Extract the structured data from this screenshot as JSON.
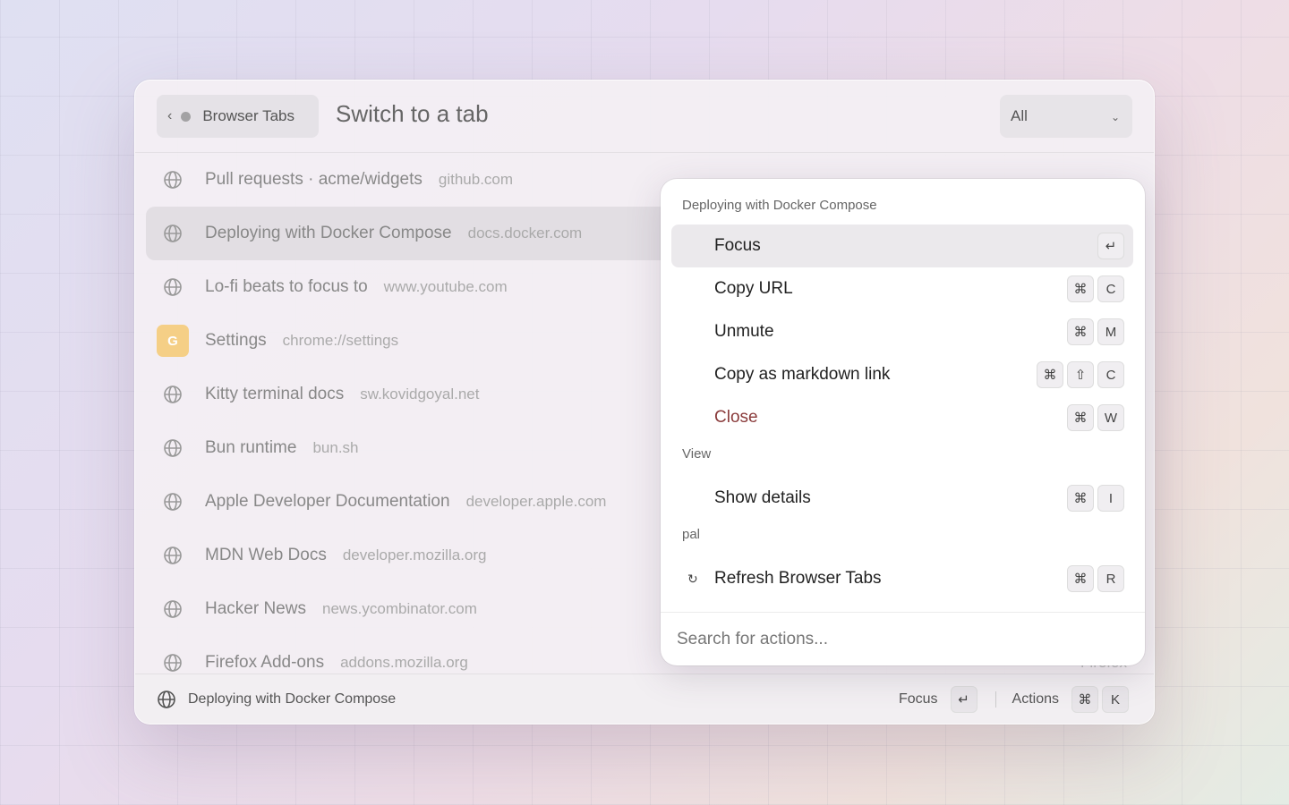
{
  "header": {
    "back_label": "Browser Tabs",
    "title": "Switch to a tab",
    "filter": {
      "selected": "All"
    }
  },
  "tabs": [
    {
      "name": "Pull requests · acme/widgets",
      "url": "github.com",
      "icon": "globe-icon"
    },
    {
      "name": "Deploying with Docker Compose",
      "url": "docs.docker.com",
      "icon": "globe-icon",
      "selected": true
    },
    {
      "name": "Lo-fi beats to focus to",
      "url": "www.youtube.com",
      "icon": "globe-icon"
    },
    {
      "name": "Settings",
      "url": "chrome://settings",
      "icon": "g-badge",
      "badge": "G"
    },
    {
      "name": "Kitty terminal docs",
      "url": "sw.kovidgoyal.net",
      "icon": "globe-icon"
    },
    {
      "name": "Bun runtime",
      "url": "bun.sh",
      "icon": "globe-icon"
    },
    {
      "name": "Apple Developer Documentation",
      "url": "developer.apple.com",
      "icon": "globe-icon"
    },
    {
      "name": "MDN Web Docs",
      "url": "developer.mozilla.org",
      "icon": "globe-icon"
    },
    {
      "name": "Hacker News",
      "url": "news.ycombinator.com",
      "icon": "globe-icon"
    },
    {
      "name": "Firefox Add-ons",
      "url": "addons.mozilla.org",
      "icon": "globe-icon",
      "browser": "Firefox"
    }
  ],
  "actions_panel": {
    "title": "Deploying with Docker Compose",
    "groups": [
      {
        "label": "",
        "items": [
          {
            "label": "Focus",
            "keys": [
              "↵"
            ],
            "active": true
          },
          {
            "label": "Copy URL",
            "keys": [
              "⌘",
              "C"
            ]
          },
          {
            "label": "Unmute",
            "keys": [
              "⌘",
              "M"
            ]
          },
          {
            "label": "Copy as markdown link",
            "keys": [
              "⌘",
              "⇧",
              "C"
            ]
          },
          {
            "label": "Close",
            "keys": [
              "⌘",
              "W"
            ],
            "danger": true
          }
        ]
      },
      {
        "label": "View",
        "items": [
          {
            "label": "Show details",
            "keys": [
              "⌘",
              "I"
            ]
          }
        ]
      },
      {
        "label": "pal",
        "items": [
          {
            "label": "Refresh Browser Tabs",
            "keys": [
              "⌘",
              "R"
            ],
            "icon": "↻"
          }
        ]
      }
    ],
    "search_placeholder": "Search for actions..."
  },
  "footer": {
    "current": "Deploying with Docker Compose",
    "primary_label": "Focus",
    "primary_key": "↵",
    "actions_label": "Actions",
    "actions_keys": [
      "⌘",
      "K"
    ]
  },
  "colors": {
    "danger": "#8a3b3b",
    "badge_bg": "#f5cf86",
    "selected_row": "#dcd8de"
  }
}
